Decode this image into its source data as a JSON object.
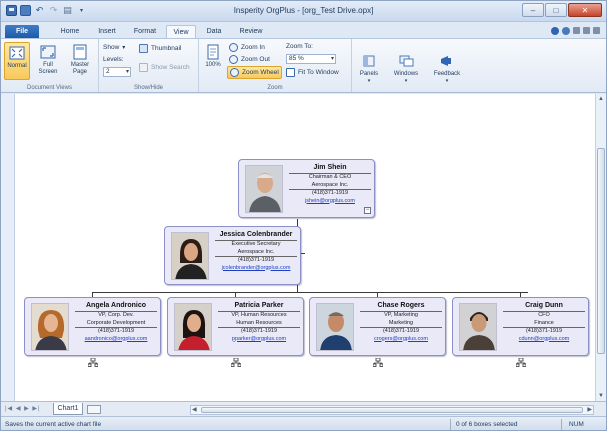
{
  "window": {
    "title": "Insperity OrgPlus - [org_Test Drive.opx]"
  },
  "tabs": [
    "File",
    "Home",
    "Insert",
    "Format",
    "View",
    "Data",
    "Review"
  ],
  "active_tab": "View",
  "ribbon": {
    "document_views": {
      "label": "Document Views",
      "normal": "Normal",
      "full_screen": "Full Screen",
      "master_page": "Master Page"
    },
    "show_hide": {
      "label": "Show/Hide",
      "show": "Show",
      "levels_label": "Levels:",
      "levels_value": "2",
      "thumbnail": "Thumbnail",
      "show_search": "Show Search"
    },
    "zoom": {
      "label": "Zoom",
      "percent_btn": "100%",
      "zoom_in": "Zoom In",
      "zoom_out": "Zoom Out",
      "zoom_wheel": "Zoom Wheel",
      "zoom_to_label": "Zoom To:",
      "zoom_to_value": "85 %",
      "fit_to_window": "Fit To Window"
    },
    "panels": "Panels",
    "windows": "Windows",
    "feedback": "Feedback"
  },
  "org": {
    "top": {
      "name": "Jim Shein",
      "title": "Chairman & CEO",
      "dept": "Aerospace Inc.",
      "phone": "(418)371-1919",
      "email": "jshein@orgplus.com",
      "expander": "−"
    },
    "assistant": {
      "name": "Jessica Colenbrander",
      "title": "Executive Secretary",
      "dept": "Aerospace Inc.",
      "phone": "(418)371-1919",
      "email": "jcolenbrander@orgplus.com"
    },
    "reports": [
      {
        "name": "Angela Andronico",
        "title": "VP, Corp. Dev.",
        "dept": "Corporate Development",
        "phone": "(418)371-1919",
        "email": "aandronico@orgplus.com"
      },
      {
        "name": "Patricia Parker",
        "title": "VP, Human Resources",
        "dept": "Human Resources",
        "phone": "(418)371-1919",
        "email": "pparker@orgplus.com"
      },
      {
        "name": "Chase Rogers",
        "title": "VP, Marketing",
        "dept": "Marketing",
        "phone": "(418)371-1919",
        "email": "crogers@orgplus.com"
      },
      {
        "name": "Craig Dunn",
        "title": "CFO",
        "dept": "Finance",
        "phone": "(418)371-1919",
        "email": "cdunn@orgplus.com"
      }
    ]
  },
  "sheet_tab": "Chart1",
  "status": {
    "left": "Saves the current active chart file",
    "selection": "0 of 6 boxes selected",
    "mode": "NUM"
  },
  "colors": {
    "box_fill": "#e9e9f8",
    "box_border": "#8c8fc6",
    "link": "#1d3fc4",
    "file_tab": "#2a67b6"
  }
}
